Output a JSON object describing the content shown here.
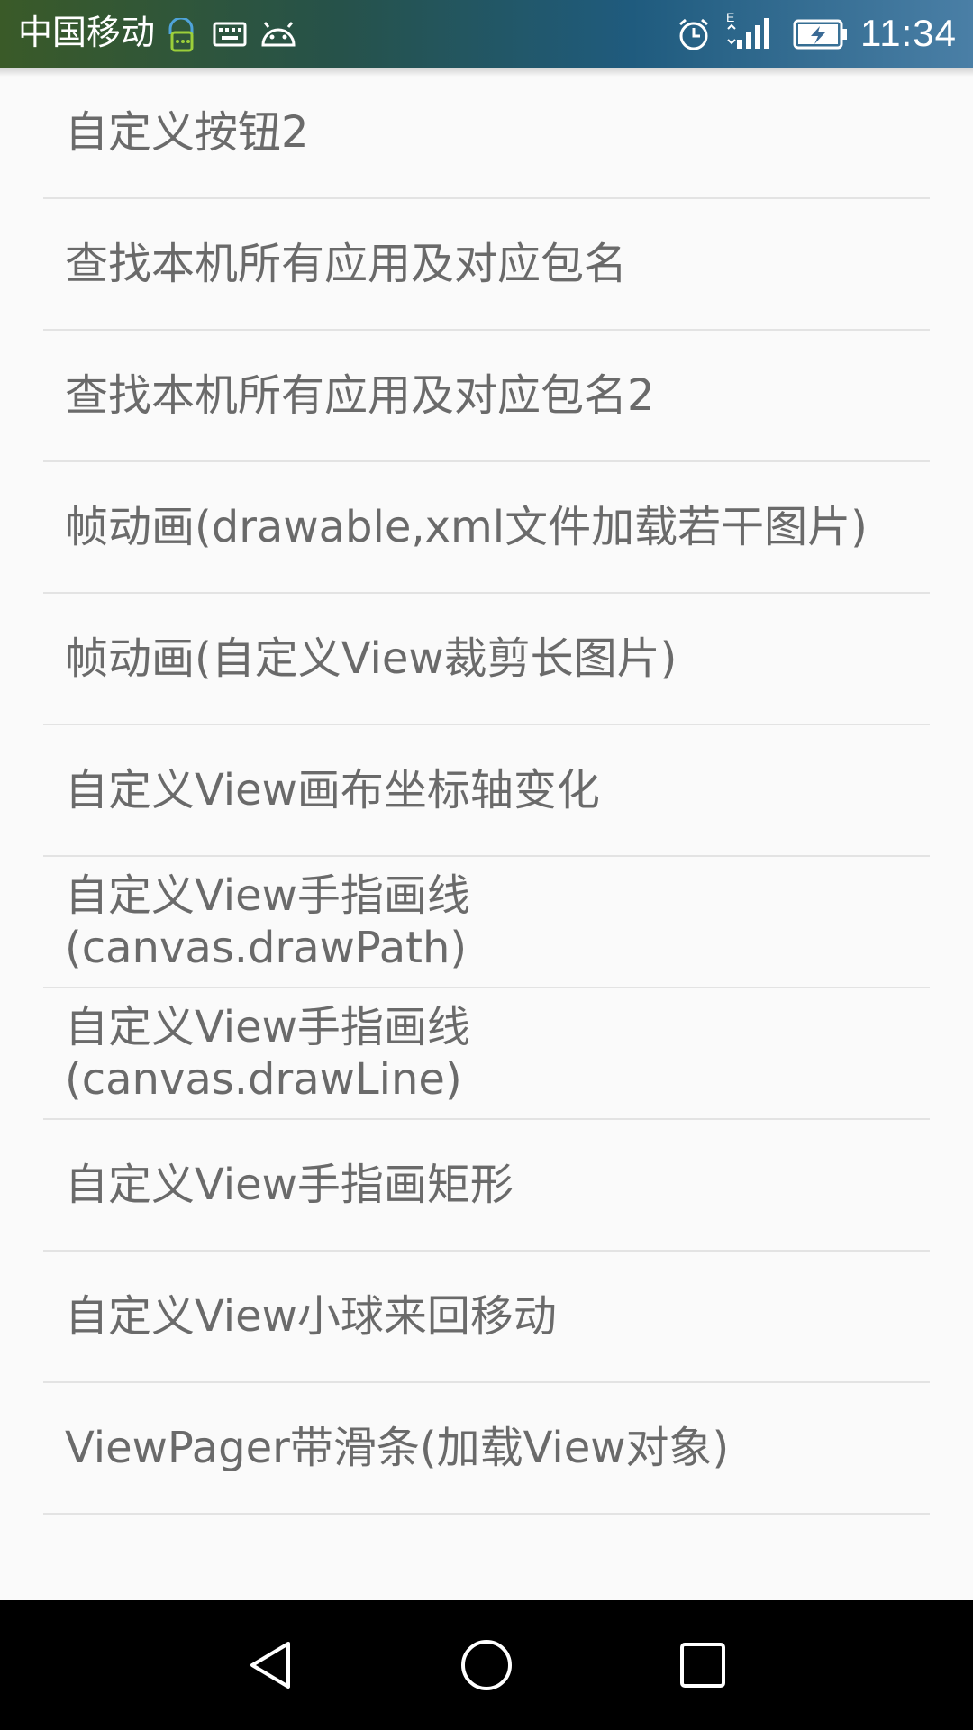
{
  "status_bar": {
    "carrier": "中国移动",
    "network_type": "E",
    "time": "11:34",
    "icons": [
      "notification-lock-icon",
      "keyboard-icon",
      "android-icon",
      "alarm-icon",
      "signal-icon",
      "battery-charging-icon"
    ]
  },
  "list": {
    "items": [
      "自定义按钮2",
      "查找本机所有应用及对应包名",
      "查找本机所有应用及对应包名2",
      "帧动画(drawable,xml文件加载若干图片)",
      "帧动画(自定义View裁剪长图片)",
      "自定义View画布坐标轴变化",
      "自定义View手指画线(canvas.drawPath)",
      "自定义View手指画线(canvas.drawLine)",
      "自定义View手指画矩形",
      "自定义View小球来回移动",
      "ViewPager带滑条(加载View对象)"
    ]
  },
  "nav_bar": {
    "buttons": [
      "back-icon",
      "home-icon",
      "recents-icon"
    ]
  },
  "colors": {
    "background": "#fafafa",
    "text": "#6a6a6a",
    "divider": "#e3e3e3",
    "nav_bar": "#000000"
  }
}
